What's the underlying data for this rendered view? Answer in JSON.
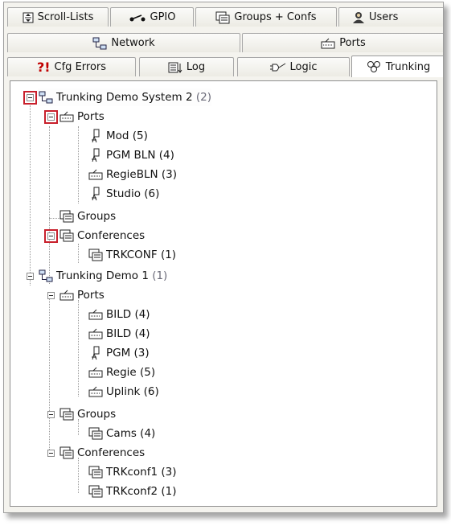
{
  "tabs": {
    "row1": [
      {
        "label": "Scroll-Lists",
        "icon": "scroll-list-icon"
      },
      {
        "label": "GPIO",
        "icon": "gpio-icon"
      },
      {
        "label": "Groups + Confs",
        "icon": "groups-icon"
      },
      {
        "label": "Users",
        "icon": "user-icon"
      }
    ],
    "row2": [
      {
        "label": "Network",
        "icon": "network-icon"
      },
      {
        "label": "Ports",
        "icon": "port-icon"
      }
    ],
    "row3": [
      {
        "label": "Cfg Errors",
        "icon": "error-icon",
        "prefix": "?!"
      },
      {
        "label": "Log",
        "icon": "log-icon"
      },
      {
        "label": "Logic",
        "icon": "logic-icon"
      },
      {
        "label": "Trunking",
        "icon": "trunking-icon",
        "active": true
      }
    ]
  },
  "tree": {
    "systems": [
      {
        "label": "Trunking Demo System 2",
        "count": "(2)",
        "ports_label": "Ports",
        "ports": [
          {
            "label": "Mod (5)",
            "icon": "mic-icon"
          },
          {
            "label": "PGM BLN (4)",
            "icon": "mic-icon"
          },
          {
            "label": "RegieBLN (3)",
            "icon": "panel-icon"
          },
          {
            "label": "Studio (6)",
            "icon": "mic-icon"
          }
        ],
        "groups_label": "Groups",
        "groups": [],
        "conferences_label": "Conferences",
        "conferences": [
          {
            "label": "TRKCONF (1)"
          }
        ]
      },
      {
        "label": "Trunking Demo 1",
        "count": "(1)",
        "ports_label": "Ports",
        "ports": [
          {
            "label": "BILD (4)",
            "icon": "panel-icon"
          },
          {
            "label": "BILD (4)",
            "icon": "panel-icon"
          },
          {
            "label": "PGM (3)",
            "icon": "mic-icon"
          },
          {
            "label": "Regie (5)",
            "icon": "panel-icon"
          },
          {
            "label": "Uplink (6)",
            "icon": "panel-icon"
          }
        ],
        "groups_label": "Groups",
        "groups": [
          {
            "label": "Cams (4)"
          }
        ],
        "conferences_label": "Conferences",
        "conferences": [
          {
            "label": "TRKconf1 (3)"
          },
          {
            "label": "TRKconf2 (1)"
          }
        ]
      }
    ]
  },
  "colors": {
    "highlight_box": "#c8202c",
    "count_text": "#6a6a78",
    "error_icon": "#c00000"
  }
}
